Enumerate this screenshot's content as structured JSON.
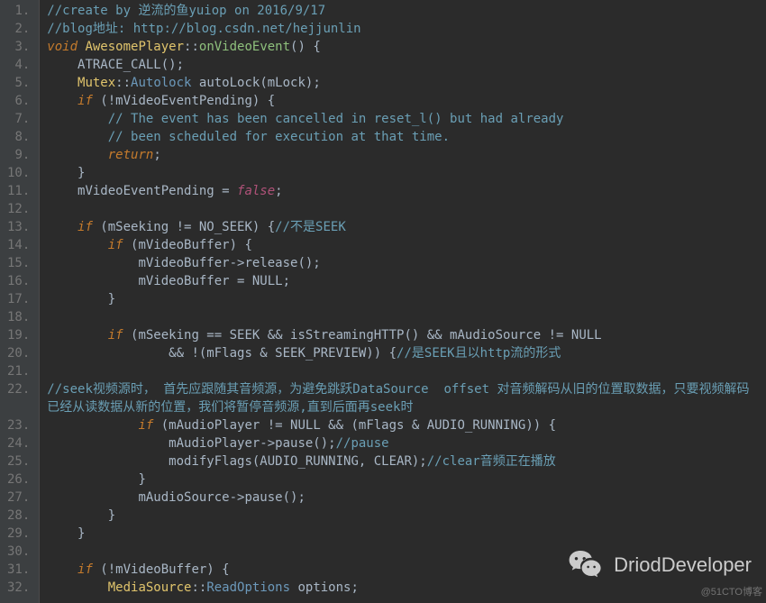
{
  "lines": [
    {
      "n": "1.",
      "seg": [
        [
          "c-comment",
          "//create by 逆流的鱼yuiop on 2016/9/17"
        ]
      ]
    },
    {
      "n": "2.",
      "seg": [
        [
          "c-comment",
          "//blog地址: http://blog.csdn.net/hejjunlin"
        ]
      ]
    },
    {
      "n": "3.",
      "seg": [
        [
          "c-kw",
          "void"
        ],
        [
          "c-text",
          " "
        ],
        [
          "c-class",
          "AwesomePlayer"
        ],
        [
          "c-op",
          "::"
        ],
        [
          "c-func",
          "onVideoEvent"
        ],
        [
          "c-op",
          "() {"
        ]
      ]
    },
    {
      "n": "4.",
      "seg": [
        [
          "c-text",
          "    ATRACE_CALL();"
        ]
      ]
    },
    {
      "n": "5.",
      "seg": [
        [
          "c-text",
          "    "
        ],
        [
          "c-class",
          "Mutex"
        ],
        [
          "c-op",
          "::"
        ],
        [
          "c-type",
          "Autolock"
        ],
        [
          "c-text",
          " autoLock(mLock);"
        ]
      ]
    },
    {
      "n": "6.",
      "seg": [
        [
          "c-text",
          "    "
        ],
        [
          "c-kw",
          "if"
        ],
        [
          "c-text",
          " (!mVideoEventPending) {"
        ]
      ]
    },
    {
      "n": "7.",
      "seg": [
        [
          "c-text",
          "        "
        ],
        [
          "c-comment",
          "// The event has been cancelled in reset_l() but had already"
        ]
      ]
    },
    {
      "n": "8.",
      "seg": [
        [
          "c-text",
          "        "
        ],
        [
          "c-comment",
          "// been scheduled for execution at that time."
        ]
      ]
    },
    {
      "n": "9.",
      "seg": [
        [
          "c-text",
          "        "
        ],
        [
          "c-kw",
          "return"
        ],
        [
          "c-text",
          ";"
        ]
      ]
    },
    {
      "n": "10.",
      "seg": [
        [
          "c-text",
          "    }"
        ]
      ]
    },
    {
      "n": "11.",
      "seg": [
        [
          "c-text",
          "    mVideoEventPending = "
        ],
        [
          "c-const",
          "false"
        ],
        [
          "c-text",
          ";"
        ]
      ]
    },
    {
      "n": "12.",
      "seg": [
        [
          "c-text",
          " "
        ]
      ]
    },
    {
      "n": "13.",
      "seg": [
        [
          "c-text",
          "    "
        ],
        [
          "c-kw",
          "if"
        ],
        [
          "c-text",
          " (mSeeking != NO_SEEK) {"
        ],
        [
          "c-comment",
          "//不是SEEK"
        ]
      ]
    },
    {
      "n": "14.",
      "seg": [
        [
          "c-text",
          "        "
        ],
        [
          "c-kw",
          "if"
        ],
        [
          "c-text",
          " (mVideoBuffer) {"
        ]
      ]
    },
    {
      "n": "15.",
      "seg": [
        [
          "c-text",
          "            mVideoBuffer->release();"
        ]
      ]
    },
    {
      "n": "16.",
      "seg": [
        [
          "c-text",
          "            mVideoBuffer = NULL;"
        ]
      ]
    },
    {
      "n": "17.",
      "seg": [
        [
          "c-text",
          "        }"
        ]
      ]
    },
    {
      "n": "18.",
      "seg": [
        [
          "c-text",
          " "
        ]
      ]
    },
    {
      "n": "19.",
      "seg": [
        [
          "c-text",
          "        "
        ],
        [
          "c-kw",
          "if"
        ],
        [
          "c-text",
          " (mSeeking == SEEK && isStreamingHTTP() && mAudioSource != NULL"
        ]
      ]
    },
    {
      "n": "20.",
      "seg": [
        [
          "c-text",
          "                && !(mFlags & SEEK_PREVIEW)) {"
        ],
        [
          "c-comment",
          "//是SEEK且以http流的形式"
        ]
      ]
    },
    {
      "n": "21.",
      "seg": [
        [
          "c-text",
          " "
        ]
      ]
    },
    {
      "n": "22.",
      "wrap": true,
      "seg": [
        [
          [
            "c-comment",
            "//seek视频源时， 首先应跟随其音频源，为避免跳跃DataSource  offset 对音频解码从旧的位置取数据，只要视频解码"
          ]
        ],
        [
          [
            "c-comment",
            "已经从读数据从新的位置，我们将暂停音频源,直到后面再seek时"
          ]
        ]
      ]
    },
    {
      "n": "23.",
      "seg": [
        [
          "c-text",
          "            "
        ],
        [
          "c-kw",
          "if"
        ],
        [
          "c-text",
          " (mAudioPlayer != NULL && (mFlags & AUDIO_RUNNING)) {"
        ]
      ]
    },
    {
      "n": "24.",
      "seg": [
        [
          "c-text",
          "                mAudioPlayer->pause();"
        ],
        [
          "c-comment",
          "//pause"
        ]
      ]
    },
    {
      "n": "25.",
      "seg": [
        [
          "c-text",
          "                modifyFlags(AUDIO_RUNNING, CLEAR);"
        ],
        [
          "c-comment",
          "//clear音频正在播放"
        ]
      ]
    },
    {
      "n": "26.",
      "seg": [
        [
          "c-text",
          "            }"
        ]
      ]
    },
    {
      "n": "27.",
      "seg": [
        [
          "c-text",
          "            mAudioSource->pause();"
        ]
      ]
    },
    {
      "n": "28.",
      "seg": [
        [
          "c-text",
          "        }"
        ]
      ]
    },
    {
      "n": "29.",
      "seg": [
        [
          "c-text",
          "    }"
        ]
      ]
    },
    {
      "n": "30.",
      "seg": [
        [
          "c-text",
          " "
        ]
      ]
    },
    {
      "n": "31.",
      "seg": [
        [
          "c-text",
          "    "
        ],
        [
          "c-kw",
          "if"
        ],
        [
          "c-text",
          " (!mVideoBuffer) {"
        ]
      ]
    },
    {
      "n": "32.",
      "seg": [
        [
          "c-text",
          "        "
        ],
        [
          "c-class",
          "MediaSource"
        ],
        [
          "c-op",
          "::"
        ],
        [
          "c-type",
          "ReadOptions"
        ],
        [
          "c-text",
          " options;"
        ]
      ]
    }
  ],
  "watermark_text": "DriodDeveloper",
  "credit_text": "@51CTO博客"
}
